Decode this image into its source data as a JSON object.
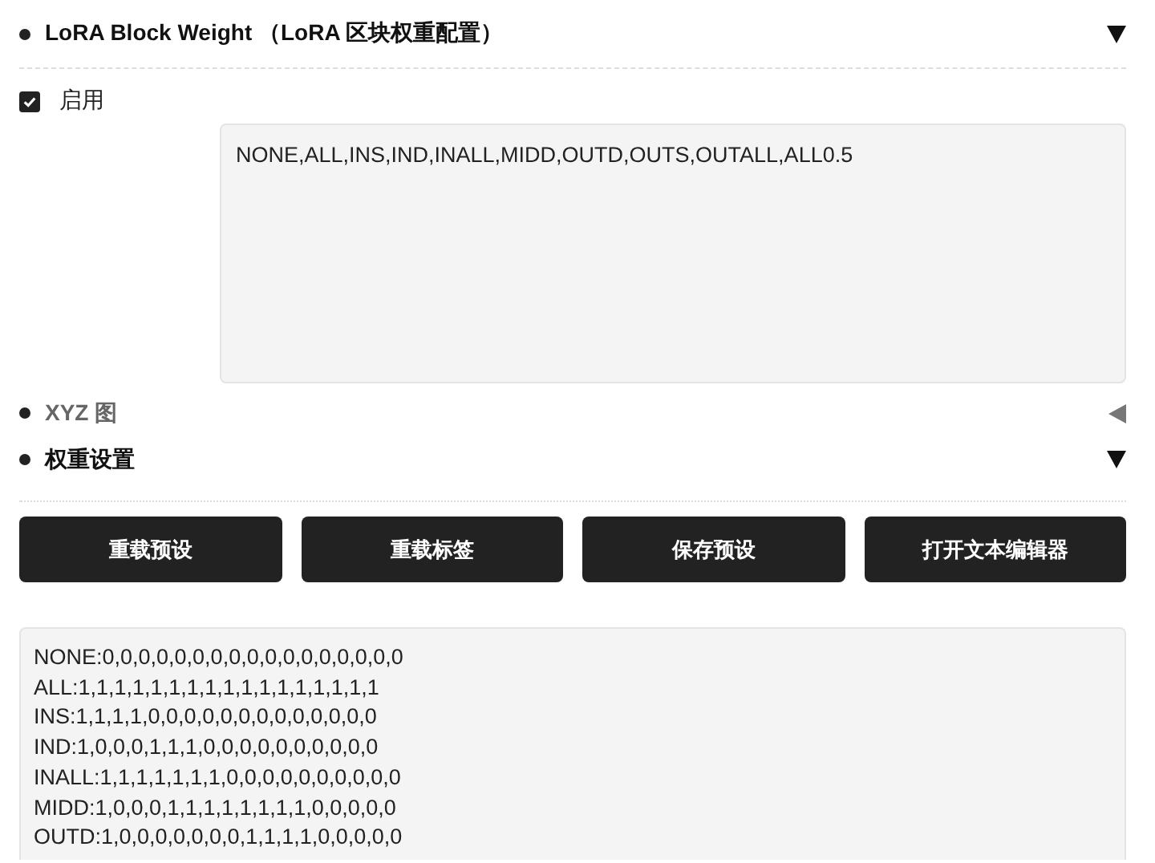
{
  "sections": [
    {
      "title": "LoRA Block Weight （LoRA 区块权重配置）",
      "expanded": true
    }
  ],
  "enable": {
    "label": "启用",
    "checked": true
  },
  "preset_field": {
    "value": "NONE,ALL,INS,IND,INALL,MIDD,OUTD,OUTS,OUTALL,ALL0.5"
  },
  "subsections": [
    {
      "title": "XYZ 图",
      "expanded": false
    },
    {
      "title": "权重设置",
      "expanded": true
    }
  ],
  "buttons": [
    "重载预设",
    "重载标签",
    "保存预设",
    "打开文本编辑器"
  ],
  "weights_field": {
    "lines": [
      "NONE:0,0,0,0,0,0,0,0,0,0,0,0,0,0,0,0,0",
      "ALL:1,1,1,1,1,1,1,1,1,1,1,1,1,1,1,1,1",
      "INS:1,1,1,1,0,0,0,0,0,0,0,0,0,0,0,0,0",
      "IND:1,0,0,0,1,1,1,0,0,0,0,0,0,0,0,0,0",
      "INALL:1,1,1,1,1,1,1,0,0,0,0,0,0,0,0,0,0",
      "MIDD:1,0,0,0,1,1,1,1,1,1,1,1,0,0,0,0,0",
      "OUTD:1,0,0,0,0,0,0,0,1,1,1,1,0,0,0,0,0"
    ]
  }
}
